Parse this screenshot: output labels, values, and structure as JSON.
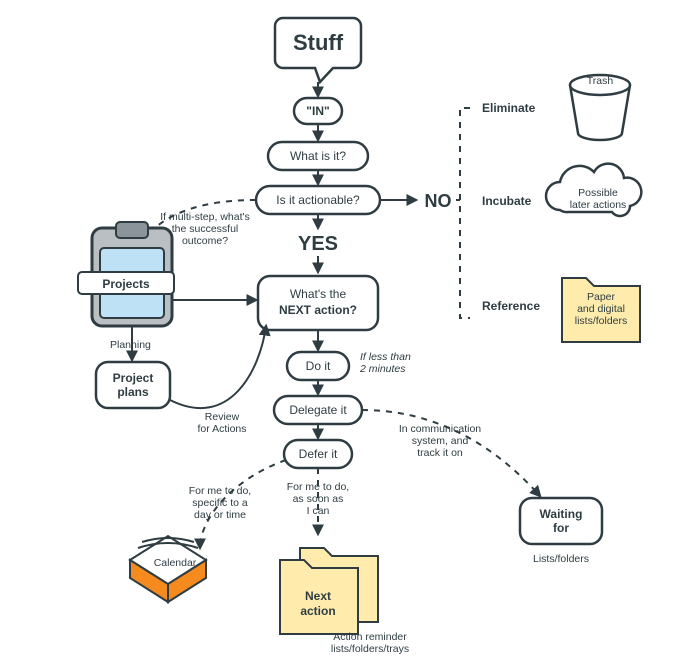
{
  "chart_data": {
    "type": "flowchart",
    "title": "GTD Workflow",
    "start": "stuff",
    "nodes": {
      "stuff": {
        "label": "Stuff",
        "shape": "callout"
      },
      "in": {
        "label": "\"IN\"",
        "shape": "pill"
      },
      "what": {
        "label": "What is it?",
        "shape": "pill"
      },
      "actionable": {
        "label": "Is it actionable?",
        "shape": "pill",
        "decision": true
      },
      "yes": {
        "label": "YES",
        "shape": "text"
      },
      "no": {
        "label": "NO",
        "shape": "text"
      },
      "next": {
        "label": "What's the\nNEXT action?",
        "shape": "round-box"
      },
      "doit": {
        "label": "Do it",
        "shape": "pill"
      },
      "delegate": {
        "label": "Delegate it",
        "shape": "pill"
      },
      "defer": {
        "label": "Defer it",
        "shape": "pill"
      },
      "eliminate": {
        "label": "Eliminate",
        "shape": "label"
      },
      "incubate": {
        "label": "Incubate",
        "shape": "label"
      },
      "reference": {
        "label": "Reference",
        "shape": "label"
      },
      "trash": {
        "label": "Trash",
        "shape": "icon-trash"
      },
      "later": {
        "label": "Possible\nlater actions",
        "shape": "cloud"
      },
      "paper": {
        "label": "Paper\nand digital\nlists/folders",
        "shape": "folder"
      },
      "projects": {
        "label": "Projects",
        "shape": "icon-clipboard"
      },
      "plans": {
        "label": "Project\nplans",
        "shape": "round-box"
      },
      "calendar": {
        "label": "Calendar",
        "shape": "icon-calendar"
      },
      "nextaction": {
        "label": "Next\naction",
        "shape": "folder"
      },
      "waiting": {
        "label": "Waiting\nfor",
        "shape": "round-box"
      }
    },
    "edges": [
      {
        "from": "stuff",
        "to": "in"
      },
      {
        "from": "in",
        "to": "what"
      },
      {
        "from": "what",
        "to": "actionable"
      },
      {
        "from": "actionable",
        "to": "yes",
        "label": "YES"
      },
      {
        "from": "actionable",
        "to": "no",
        "label": "NO"
      },
      {
        "from": "yes",
        "to": "next"
      },
      {
        "from": "next",
        "to": "doit",
        "note": "If less than 2 minutes"
      },
      {
        "from": "doit",
        "to": "delegate"
      },
      {
        "from": "delegate",
        "to": "defer"
      },
      {
        "from": "no",
        "to": "eliminate",
        "style": "dashed-bracket"
      },
      {
        "from": "no",
        "to": "incubate",
        "style": "dashed-bracket"
      },
      {
        "from": "no",
        "to": "reference",
        "style": "dashed-bracket"
      },
      {
        "from": "eliminate",
        "to": "trash"
      },
      {
        "from": "incubate",
        "to": "later"
      },
      {
        "from": "reference",
        "to": "paper"
      },
      {
        "from": "next",
        "to": "projects",
        "label": "If multi-step, what's the successful outcome?",
        "style": "dashed"
      },
      {
        "from": "projects",
        "to": "next"
      },
      {
        "from": "projects",
        "to": "plans",
        "label": "Planning"
      },
      {
        "from": "plans",
        "to": "next",
        "label": "Review for Actions"
      },
      {
        "from": "delegate",
        "to": "waiting",
        "label": "In communication system, and track it on",
        "style": "dashed"
      },
      {
        "from": "defer",
        "to": "calendar",
        "label": "For me to do, specific to a day or time",
        "style": "dashed"
      },
      {
        "from": "defer",
        "to": "nextaction",
        "label": "For me to do, as soon as I can",
        "style": "dashed"
      }
    ],
    "captions": {
      "waiting": "Lists/folders",
      "nextaction": "Action reminder lists/folders/trays"
    }
  },
  "txt": {
    "stuff": "Stuff",
    "in": "\"IN\"",
    "what": "What is it?",
    "actionable": "Is it actionable?",
    "yes": "YES",
    "no": "NO",
    "next1": "What's the",
    "next2": "NEXT action?",
    "doit": "Do it",
    "doit_note1": "If less than",
    "doit_note2": "2 minutes",
    "delegate": "Delegate it",
    "defer": "Defer it",
    "eliminate": "Eliminate",
    "incubate": "Incubate",
    "reference": "Reference",
    "trash": "Trash",
    "later1": "Possible",
    "later2": "later actions",
    "paper1": "Paper",
    "paper2": "and digital",
    "paper3": "lists/folders",
    "projects": "Projects",
    "planning": "Planning",
    "plans1": "Project",
    "plans2": "plans",
    "review1": "Review",
    "review2": "for Actions",
    "multi1": "If multi-step, what's",
    "multi2": "the successful",
    "multi3": "outcome?",
    "comm1": "In communication",
    "comm2": "system, and",
    "comm3": "track it on",
    "forme_a1": "For me to do,",
    "forme_a2": "specific to a",
    "forme_a3": "day or time",
    "forme_b1": "For me to do,",
    "forme_b2": "as soon as",
    "forme_b3": "I can",
    "calendar": "Calendar",
    "nextaction1": "Next",
    "nextaction2": "action",
    "action_cap": "Action reminder",
    "action_cap2": "lists/folders/trays",
    "waiting1": "Waiting",
    "waiting2": "for",
    "waiting_cap": "Lists/folders"
  }
}
